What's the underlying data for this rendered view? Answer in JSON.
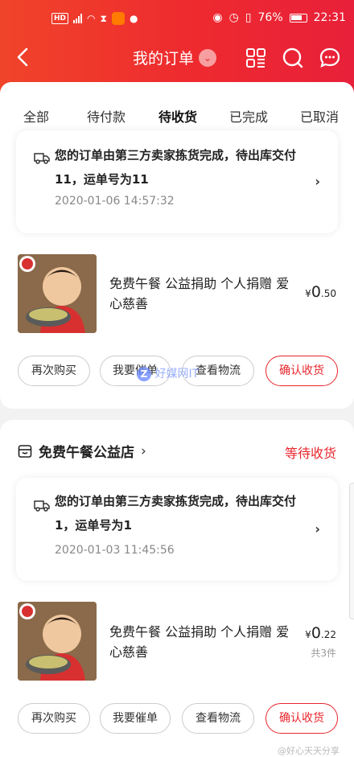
{
  "status_bar": {
    "battery": "76%",
    "time": "22:31",
    "hd": "HD"
  },
  "nav": {
    "title": "我的订单"
  },
  "tabs": [
    {
      "label": "全部"
    },
    {
      "label": "待付款"
    },
    {
      "label": "待收货"
    },
    {
      "label": "已完成"
    },
    {
      "label": "已取消"
    }
  ],
  "orders": [
    {
      "shipping_info": "您的订单由第三方卖家拣货完成，待出库交付11，运单号为11",
      "shipping_time": "2020-01-06 14:57:32",
      "product_name": "免费午餐 公益捐助 个人捐赠 爱心慈善",
      "price_symbol": "¥",
      "price_int": "0",
      "price_dec": ".50",
      "buttons": [
        "再次购买",
        "我要催单",
        "查看物流",
        "确认收货"
      ]
    },
    {
      "store_name": "免费午餐公益店",
      "status": "等待收货",
      "shipping_info": "您的订单由第三方卖家拣货完成，待出库交付1，运单号为1",
      "shipping_time": "2020-01-03 11:45:56",
      "product_name": "免费午餐 公益捐助 个人捐赠 爱心慈善",
      "price_symbol": "¥",
      "price_int": "0",
      "price_dec": ".22",
      "quantity": "共3件",
      "buttons": [
        "再次购买",
        "我要催单",
        "查看物流",
        "确认收货"
      ]
    }
  ],
  "watermarks": {
    "site": "好媒网IT",
    "weibo": "@好心天天分享"
  },
  "colors": {
    "accent": "#e8262c",
    "header": "#ee2a2f"
  }
}
